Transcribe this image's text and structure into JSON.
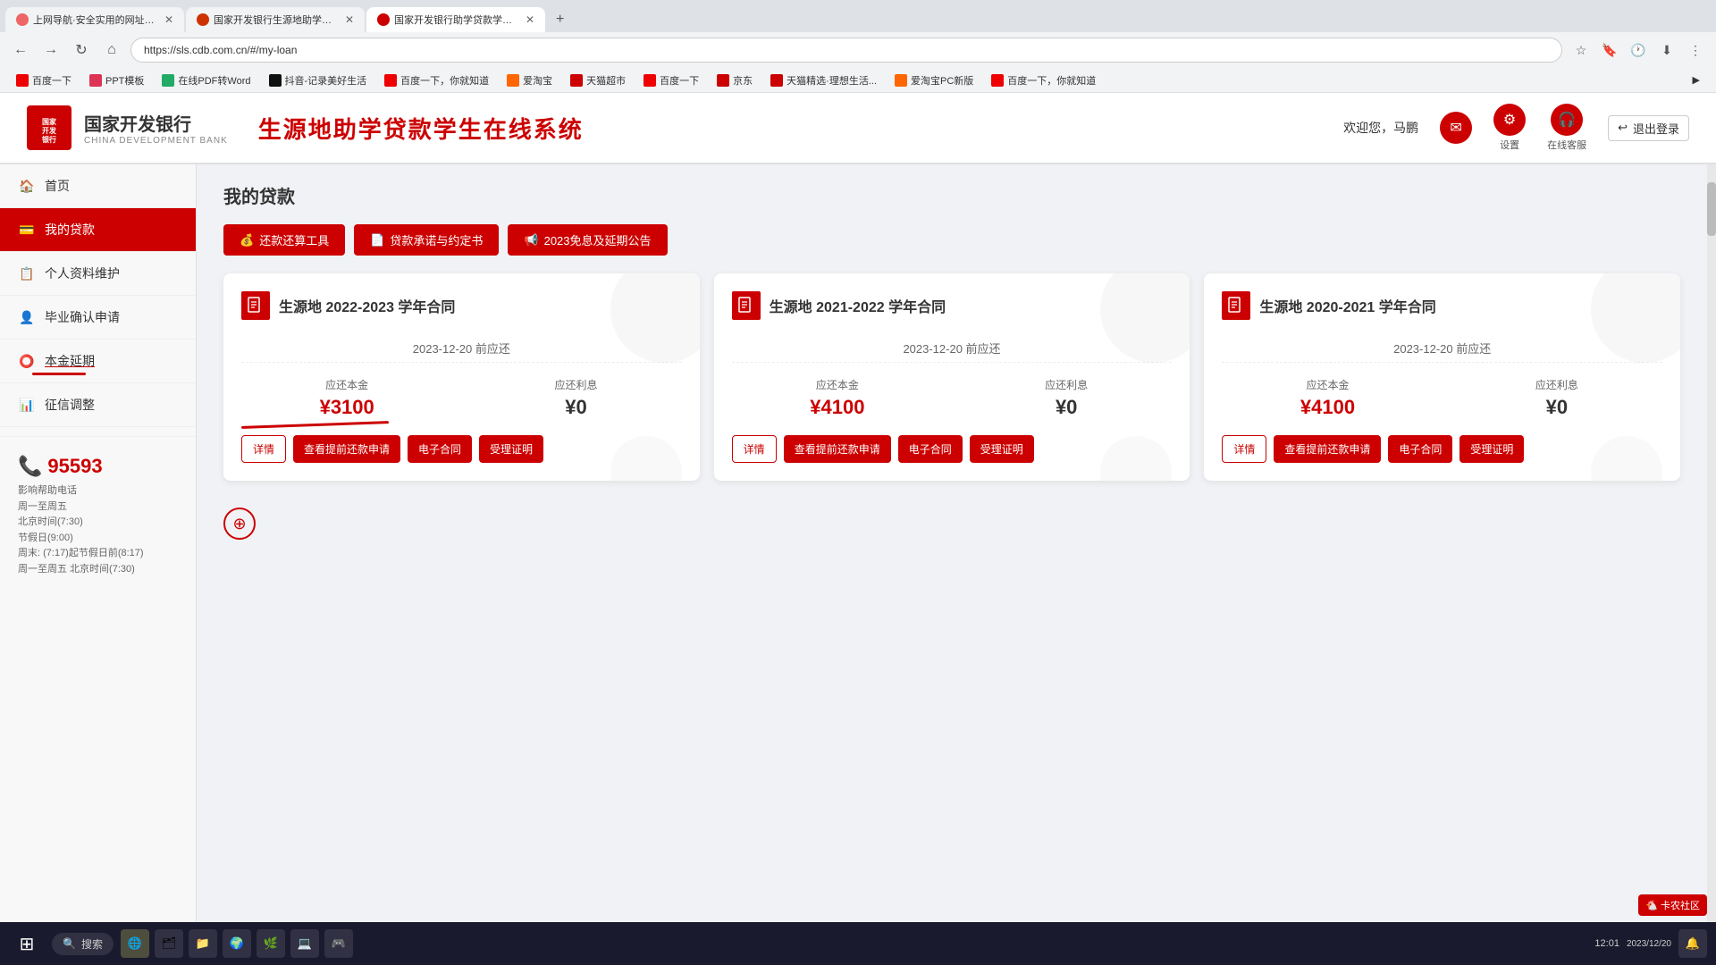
{
  "browser": {
    "tabs": [
      {
        "id": 1,
        "label": "上网导航·安全实用的网址导航",
        "active": false
      },
      {
        "id": 2,
        "label": "国家开发银行生源地助学贷款多...",
        "active": false
      },
      {
        "id": 3,
        "label": "国家开发银行助学贷款学生在线...",
        "active": true
      }
    ],
    "address": "https://sls.cdb.com.cn/#/my-loan",
    "bookmarks": [
      "百度一下",
      "PPT模板",
      "在线PDF转Word",
      "抖音-记录美好生活",
      "百度一下，你就知道",
      "爱淘宝",
      "天猫超市",
      "百度一下",
      "京东",
      "天猫精选·理想生活...",
      "爱淘宝PC新版",
      "百度一下，你就知道"
    ]
  },
  "header": {
    "logo_text": "国家开发银行",
    "logo_en": "CHINA DEVELOPMENT BANK",
    "site_title": "生源地助学贷款学生在线系统",
    "welcome": "欢迎您，马鹏",
    "msg_icon": "✉",
    "settings_label": "设置",
    "service_label": "在线客服",
    "logout_label": "退出登录"
  },
  "sidebar": {
    "items": [
      {
        "id": "home",
        "label": "首页",
        "icon": "🏠",
        "active": false
      },
      {
        "id": "my-loan",
        "label": "我的贷款",
        "icon": "💳",
        "active": true
      },
      {
        "id": "profile",
        "label": "个人资料维护",
        "icon": "📋",
        "active": false
      },
      {
        "id": "graduation",
        "label": "毕业确认申请",
        "icon": "👤",
        "active": false
      },
      {
        "id": "extension",
        "label": "本金延期",
        "icon": "⭕",
        "active": false
      },
      {
        "id": "credit",
        "label": "征信调整",
        "icon": "📊",
        "active": false
      }
    ],
    "phone": {
      "number": "95593",
      "desc1": "影响帮助电话",
      "desc2": "周一至周五",
      "desc3": "北京时间(7:30)",
      "desc4": "节假日(9:00)",
      "note": "周末: (7:17)起节假日前(8:17)",
      "note2": "周一至周五 北京时间(7:30)"
    }
  },
  "main": {
    "page_title": "我的贷款",
    "action_buttons": [
      {
        "label": "还款还算工具",
        "icon": "💰"
      },
      {
        "label": "贷款承诺与约定书",
        "icon": "📄"
      },
      {
        "label": "2023免息及延期公告",
        "icon": "📢"
      }
    ],
    "loan_cards": [
      {
        "title": "生源地 2022-2023 学年合同",
        "due_date": "2023-12-20 前应还",
        "principal_label": "应还本金",
        "principal_value": "¥3100",
        "interest_label": "应还利息",
        "interest_value": "¥0",
        "buttons": [
          "详情",
          "查看提前还款申请",
          "电子合同",
          "受理证明"
        ]
      },
      {
        "title": "生源地 2021-2022 学年合同",
        "due_date": "2023-12-20 前应还",
        "principal_label": "应还本金",
        "principal_value": "¥4100",
        "interest_label": "应还利息",
        "interest_value": "¥0",
        "buttons": [
          "详情",
          "查看提前还款申请",
          "电子合同",
          "受理证明"
        ]
      },
      {
        "title": "生源地 2020-2021 学年合同",
        "due_date": "2023-12-20 前应还",
        "principal_label": "应还本金",
        "principal_value": "¥4100",
        "interest_label": "应还利息",
        "interest_value": "¥0",
        "buttons": [
          "详情",
          "查看提前还款申请",
          "电子合同",
          "受理证明"
        ]
      }
    ]
  },
  "taskbar": {
    "search_placeholder": "搜索",
    "icons": [
      "🌐",
      "🗂",
      "📁",
      "🌍",
      "🌿",
      "💻",
      "🎮"
    ]
  },
  "watermark": {
    "text": "卡农社区"
  },
  "colors": {
    "primary": "#cc0000",
    "sidebar_active": "#cc0000",
    "text_main": "#333",
    "text_sub": "#666"
  }
}
